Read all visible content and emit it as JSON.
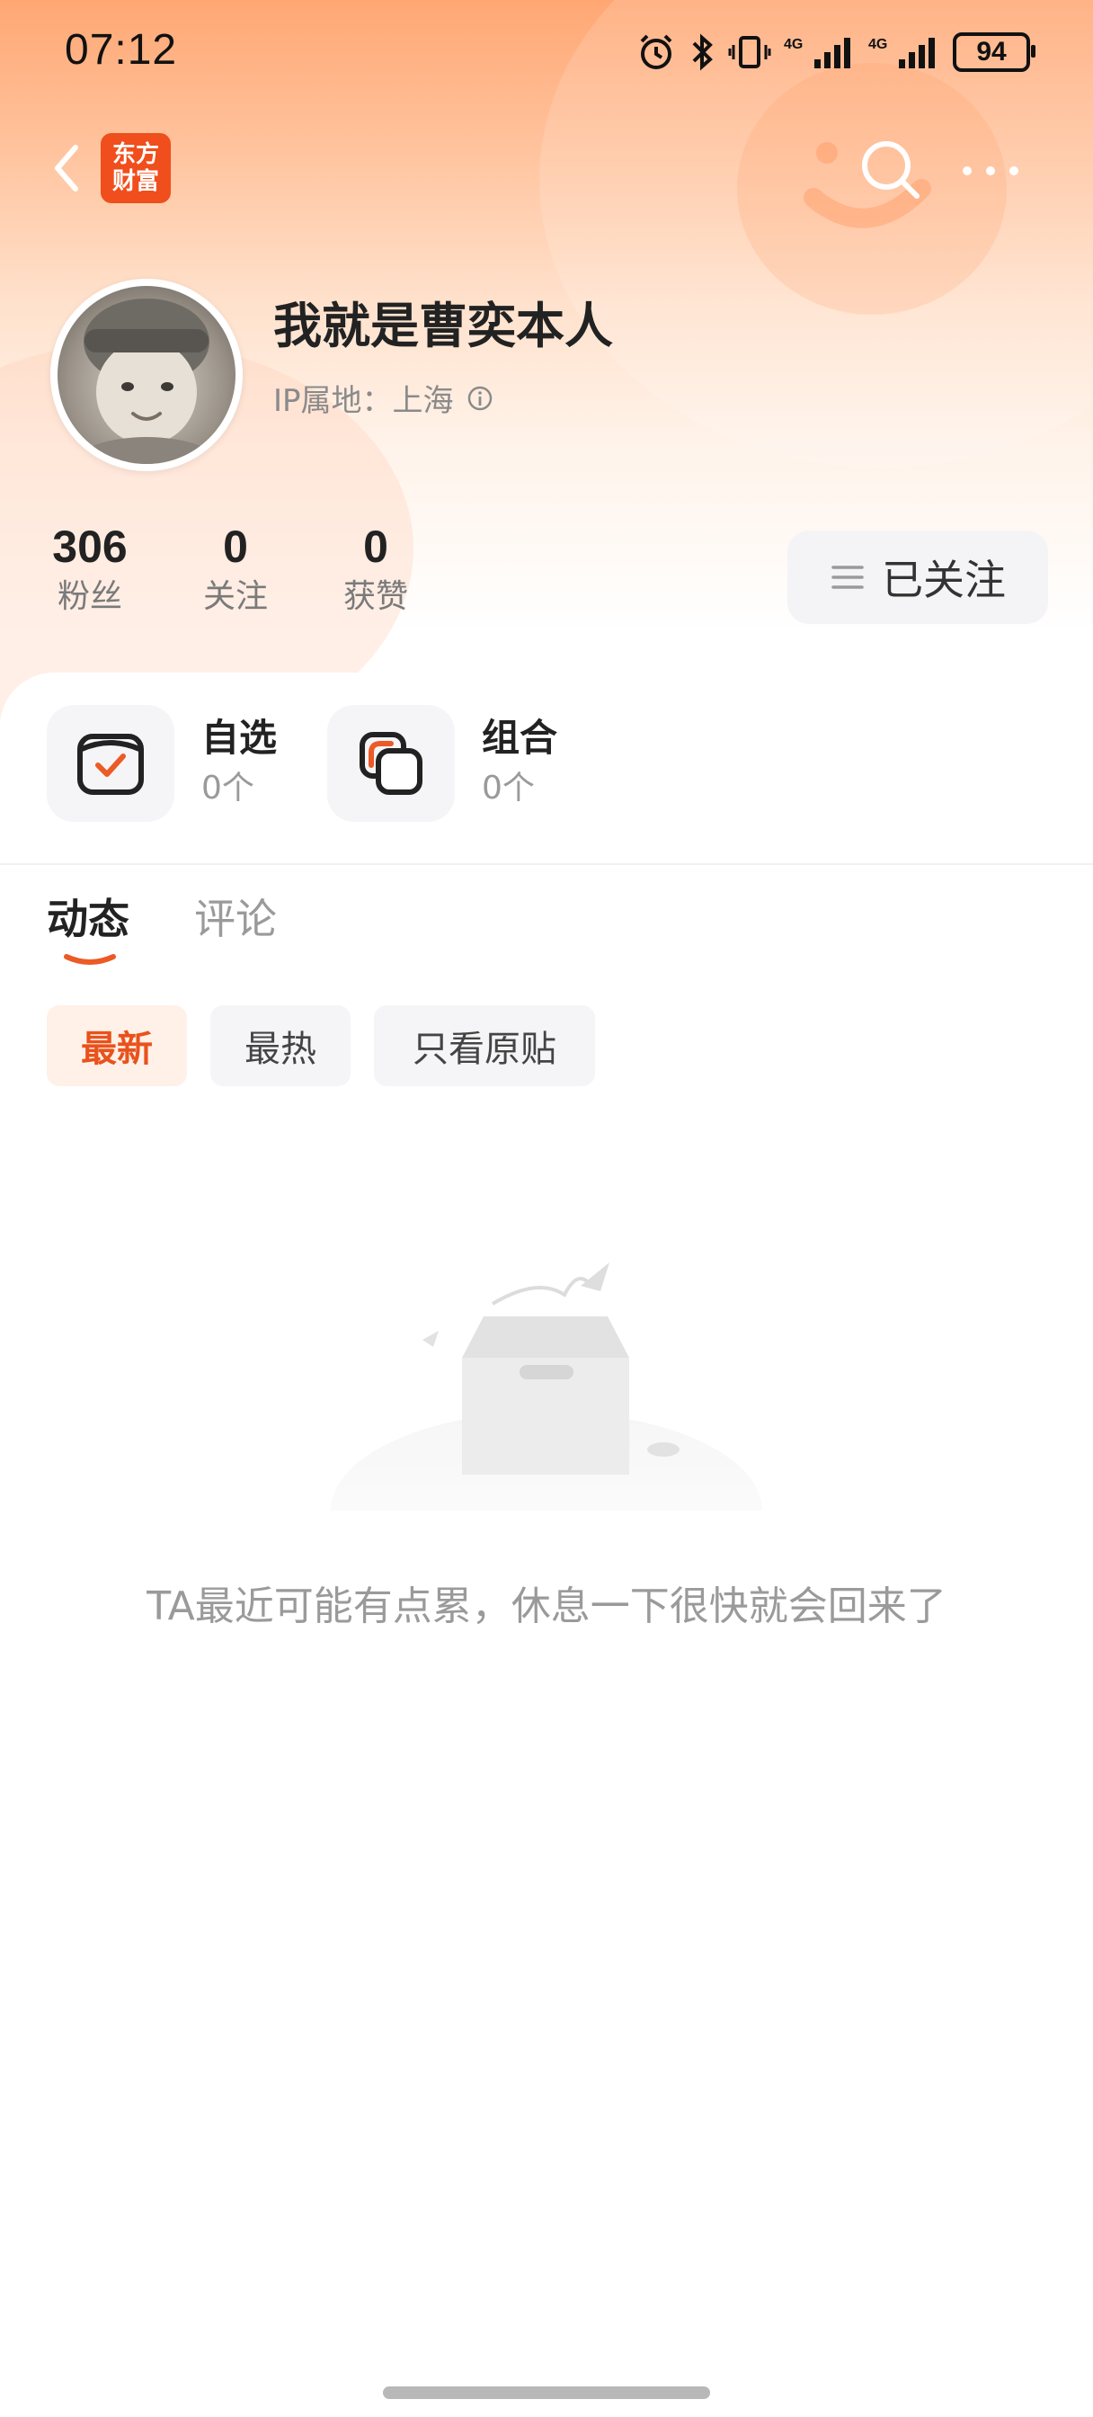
{
  "status_bar": {
    "time": "07:12",
    "battery": "94",
    "network_1": "4G",
    "network_2": "4G"
  },
  "nav": {
    "app_logo_line1": "东方",
    "app_logo_line2": "财富"
  },
  "profile": {
    "username": "我就是曹奕本人",
    "ip_location": "IP属地：上海"
  },
  "stats": [
    {
      "value": "306",
      "label": "粉丝"
    },
    {
      "value": "0",
      "label": "关注"
    },
    {
      "value": "0",
      "label": "获赞"
    }
  ],
  "follow_button": {
    "label": "已关注"
  },
  "quick_access": [
    {
      "title": "自选",
      "count": "0个",
      "icon": "checkbox-icon"
    },
    {
      "title": "组合",
      "count": "0个",
      "icon": "portfolio-icon"
    }
  ],
  "tabs": [
    {
      "label": "动态",
      "active": true
    },
    {
      "label": "评论",
      "active": false
    }
  ],
  "filters": [
    {
      "label": "最新",
      "active": true
    },
    {
      "label": "最热",
      "active": false
    },
    {
      "label": "只看原贴",
      "active": false
    }
  ],
  "empty_state": {
    "message": "TA最近可能有点累，休息一下很快就会回来了"
  },
  "colors": {
    "accent": "#e8521c",
    "logo_bg": "#f04e1c",
    "header_top": "#ffa773"
  }
}
